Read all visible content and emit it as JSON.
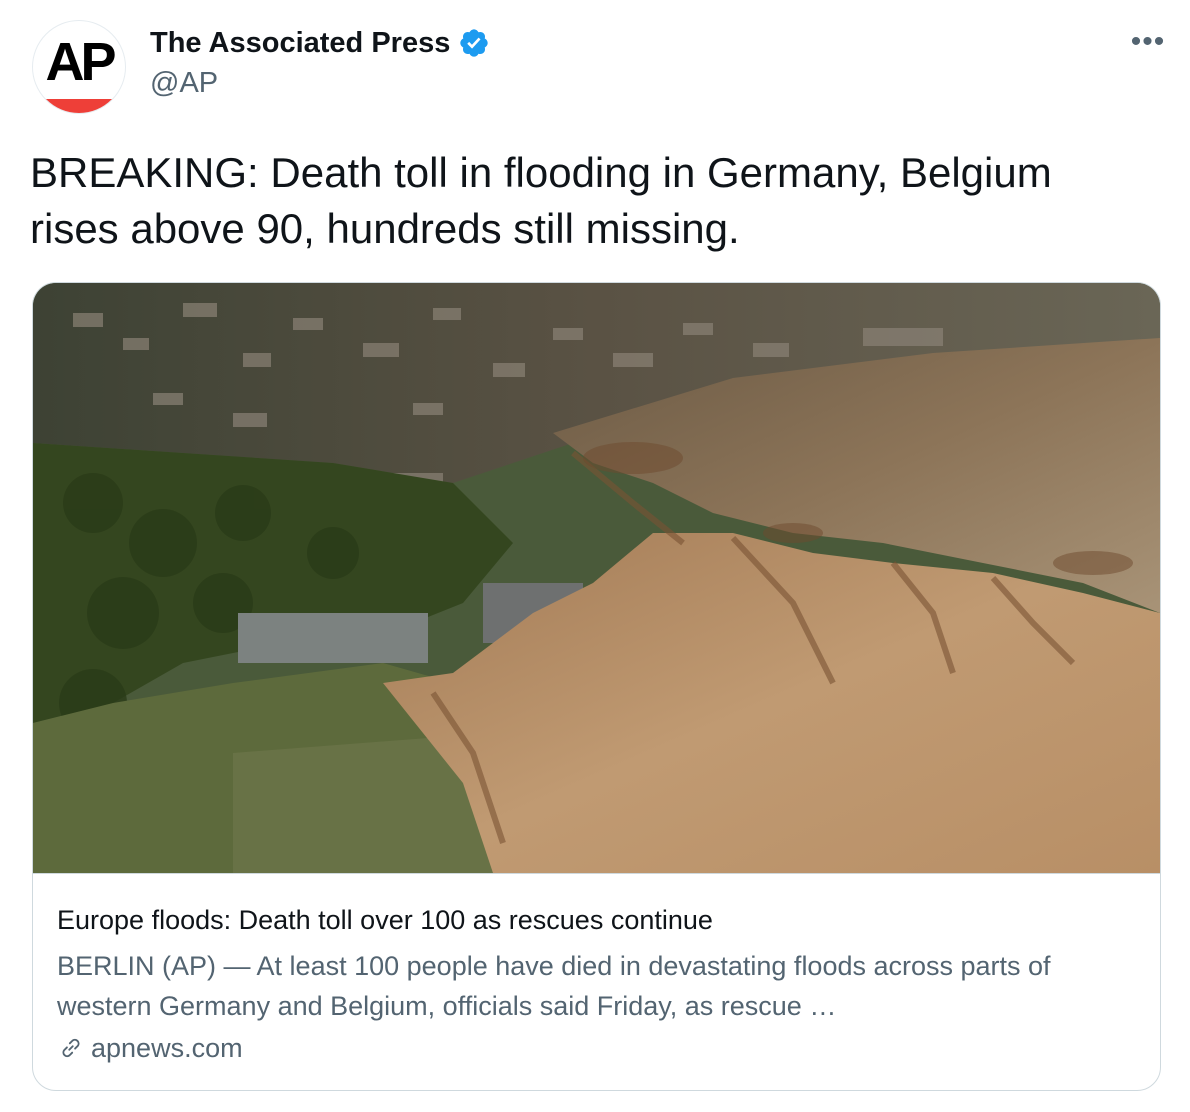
{
  "author": {
    "logo_text": "AP",
    "name": "The Associated Press",
    "handle": "@AP",
    "verified_icon": "verified-badge-icon",
    "accent_color": "#1d9bf0",
    "logo_bar_color": "#ee3f38"
  },
  "header": {
    "more_icon": "more-horizontal-icon",
    "more_glyph": "•••"
  },
  "tweet": {
    "text": "BREAKING: Death toll in flooding in Germany, Belgium rises above 90, hundreds still missing."
  },
  "card": {
    "image_description_icon": "aerial-flood-photo",
    "title": "Europe floods: Death toll over 100 as rescues continue",
    "description": "BERLIN (AP) — At least 100 people have died in devastating floods across parts of western Germany and Belgium, officials said Friday, as rescue …",
    "link_icon": "link-icon",
    "domain": "apnews.com"
  }
}
